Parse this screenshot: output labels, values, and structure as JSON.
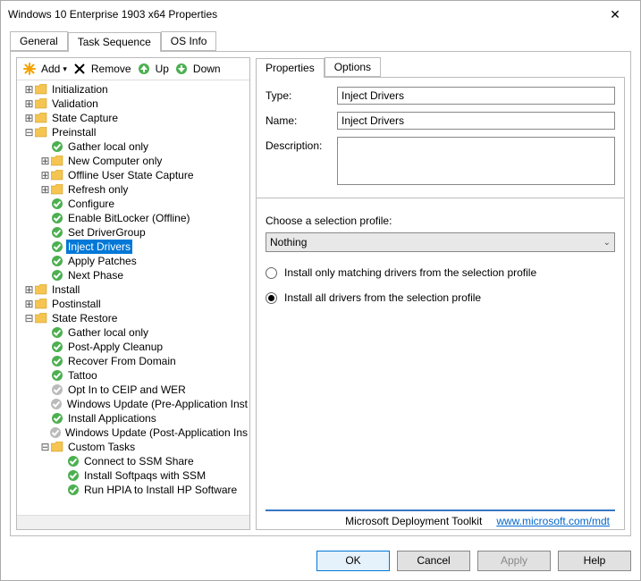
{
  "window": {
    "title": "Windows 10 Enterprise 1903 x64 Properties"
  },
  "outerTabs": [
    {
      "label": "General",
      "active": false
    },
    {
      "label": "Task Sequence",
      "active": true
    },
    {
      "label": "OS Info",
      "active": false
    }
  ],
  "toolbar": {
    "add": "Add",
    "remove": "Remove",
    "up": "Up",
    "down": "Down"
  },
  "tree": [
    {
      "d": 0,
      "exp": "+",
      "ic": "folder",
      "t": "Initialization"
    },
    {
      "d": 0,
      "exp": "+",
      "ic": "folder",
      "t": "Validation"
    },
    {
      "d": 0,
      "exp": "+",
      "ic": "folder",
      "t": "State Capture"
    },
    {
      "d": 0,
      "exp": "-",
      "ic": "folder",
      "t": "Preinstall"
    },
    {
      "d": 1,
      "ic": "check",
      "t": "Gather local only"
    },
    {
      "d": 1,
      "exp": "+",
      "ic": "folder",
      "t": "New Computer only"
    },
    {
      "d": 1,
      "exp": "+",
      "ic": "folder",
      "t": "Offline User State Capture"
    },
    {
      "d": 1,
      "exp": "+",
      "ic": "folder",
      "t": "Refresh only"
    },
    {
      "d": 1,
      "ic": "check",
      "t": "Configure"
    },
    {
      "d": 1,
      "ic": "check",
      "t": "Enable BitLocker (Offline)"
    },
    {
      "d": 1,
      "ic": "check",
      "t": "Set DriverGroup"
    },
    {
      "d": 1,
      "ic": "check",
      "t": "Inject Drivers",
      "sel": true
    },
    {
      "d": 1,
      "ic": "check",
      "t": "Apply Patches"
    },
    {
      "d": 1,
      "ic": "check",
      "t": "Next Phase"
    },
    {
      "d": 0,
      "exp": "+",
      "ic": "folder",
      "t": "Install"
    },
    {
      "d": 0,
      "exp": "+",
      "ic": "folder",
      "t": "Postinstall"
    },
    {
      "d": 0,
      "exp": "-",
      "ic": "folder",
      "t": "State Restore"
    },
    {
      "d": 1,
      "ic": "check",
      "t": "Gather local only"
    },
    {
      "d": 1,
      "ic": "check",
      "t": "Post-Apply Cleanup"
    },
    {
      "d": 1,
      "ic": "check",
      "t": "Recover From Domain"
    },
    {
      "d": 1,
      "ic": "check",
      "t": "Tattoo"
    },
    {
      "d": 1,
      "ic": "disabled",
      "t": "Opt In to CEIP and WER"
    },
    {
      "d": 1,
      "ic": "disabled",
      "t": "Windows Update (Pre-Application Inst"
    },
    {
      "d": 1,
      "ic": "check",
      "t": "Install Applications"
    },
    {
      "d": 1,
      "ic": "disabled",
      "t": "Windows Update (Post-Application Ins"
    },
    {
      "d": 1,
      "exp": "-",
      "ic": "folder",
      "t": "Custom Tasks"
    },
    {
      "d": 2,
      "ic": "check",
      "t": "Connect to SSM Share"
    },
    {
      "d": 2,
      "ic": "check",
      "t": "Install Softpaqs with SSM"
    },
    {
      "d": 2,
      "ic": "check",
      "t": "Run HPIA to Install HP Software"
    }
  ],
  "subTabs": [
    {
      "label": "Properties",
      "active": true
    },
    {
      "label": "Options",
      "active": false
    }
  ],
  "form": {
    "typeLabel": "Type:",
    "typeValue": "Inject Drivers",
    "nameLabel": "Name:",
    "nameValue": "Inject Drivers",
    "descLabel": "Description:",
    "descValue": ""
  },
  "profileSection": {
    "label": "Choose a selection profile:",
    "selected": "Nothing",
    "radio1": "Install only matching drivers from the selection profile",
    "radio2": "Install all drivers from the selection profile",
    "checked": 2
  },
  "footer": {
    "brand": "Microsoft Deployment Toolkit",
    "link": "www.microsoft.com/mdt"
  },
  "buttons": {
    "ok": "OK",
    "cancel": "Cancel",
    "apply": "Apply",
    "help": "Help"
  }
}
